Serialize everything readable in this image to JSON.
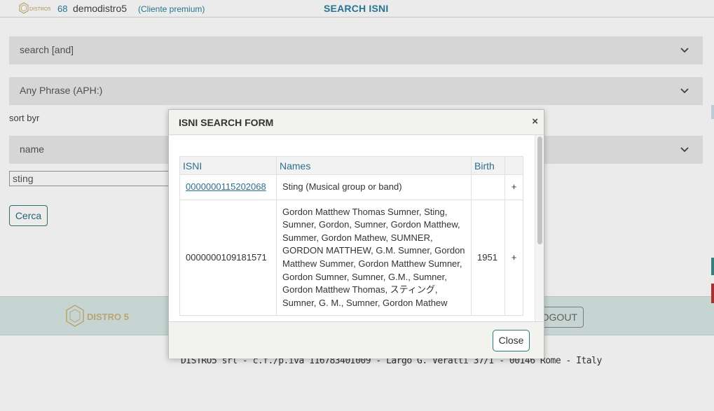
{
  "header": {
    "brand": "DISTRO5",
    "count": "68",
    "username": "demodistro5",
    "plan": "(Cliente premium)",
    "page_title": "SEARCH ISNI"
  },
  "form": {
    "search_mode": "search [and]",
    "phrase_mode": "Any Phrase (APH:)",
    "sort_label": "sort byr",
    "sort_value": "name",
    "query_value": "sting",
    "submit_label": "Cerca"
  },
  "footer": {
    "brand": "DISTRO 5",
    "logout_label": "LOGOUT",
    "visible_logout_text": "OGOUT",
    "copyright": "DISTRO5 srl - c.f./p.iva 11678340I009 - Largo G. Veratti 37/I - 00146 Rome - Italy"
  },
  "modal": {
    "title": "ISNI SEARCH FORM",
    "close_x": "×",
    "columns": [
      "ISNI",
      "Names",
      "Birth"
    ],
    "rows": [
      {
        "isni": "0000000115202068",
        "names": "Sting (Musical group or band)",
        "birth": "",
        "action": "+"
      },
      {
        "isni": "0000000109181571",
        "names": "Gordon Matthew Thomas Sumner, Sting, Sumner, Gordon, Sumner, Gordon Matthew, Summer, Gordon Mathew, SUMNER, GORDON MATTHEW, G.M. Sumner, Gordon Matthew Summer, Gordon Matthew Sumner, Gordon Sumner, Sumner, G.M., Sumner, Gordon Matthew Thomas, スティング, Sumner, G. M., Sumner, Gordon Mathew",
        "birth": "1951",
        "action": "+"
      }
    ],
    "close_button": "Close"
  },
  "colors": {
    "accent": "#2a7ea0",
    "footer_band": "#d8e8e4",
    "select_bg": "#e9e9e9"
  },
  "icons": [
    "chevron-down-icon",
    "close-icon",
    "plus-icon",
    "distro5-logo"
  ]
}
